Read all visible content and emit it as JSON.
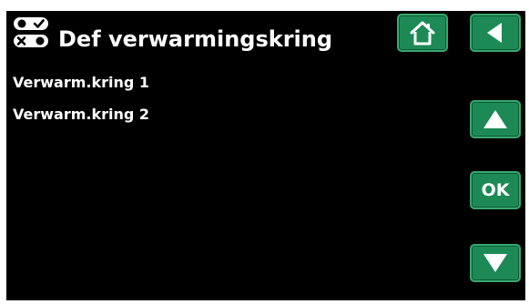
{
  "header": {
    "title": "Def verwarmingskring",
    "icon": "settings-toggles-icon"
  },
  "list": {
    "items": [
      {
        "label": "Verwarm.kring 1"
      },
      {
        "label": "Verwarm.kring 2"
      }
    ]
  },
  "buttons": {
    "home_icon": "home-icon",
    "back_icon": "back-arrow-icon",
    "up_icon": "arrow-up-icon",
    "ok_label": "OK",
    "down_icon": "arrow-down-icon"
  },
  "colors": {
    "background": "#000000",
    "button": "#1d8a55",
    "button_border": "#38a870",
    "text": "#ffffff"
  }
}
